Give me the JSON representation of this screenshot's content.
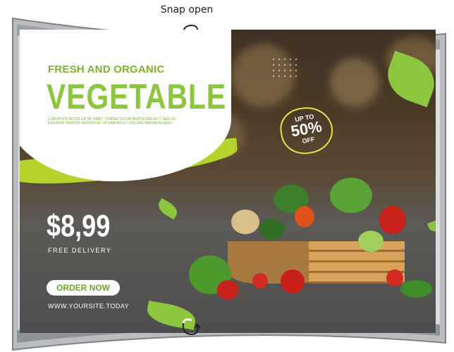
{
  "caption": "Snap open",
  "poster": {
    "headline_small": "FRESH AND ORGANIC",
    "headline_big": "VEGETABLE",
    "lorem": "LOREM IPSUM DOLOR SIT AMET, CONSECTETUR ADIPISCING ELIT, SED DO EIUSMOD TEMPOR INCIDIDUNT UT LABORE ET DOLORE MAGNA ALIQUA",
    "discount": {
      "top": "UP TO",
      "value": "50%",
      "bottom": "OFF"
    },
    "price": "$8,99",
    "delivery": "FREE DELIVERY",
    "order_button": "ORDER NOW",
    "website": "WWW.YOURSITE.TODAY"
  },
  "icons": [
    "curved-arrow-icon",
    "curved-arrow-icon"
  ],
  "colors": {
    "accent_green": "#8cc63f",
    "lime": "#b7d22d",
    "frame": "#c9cbce"
  }
}
